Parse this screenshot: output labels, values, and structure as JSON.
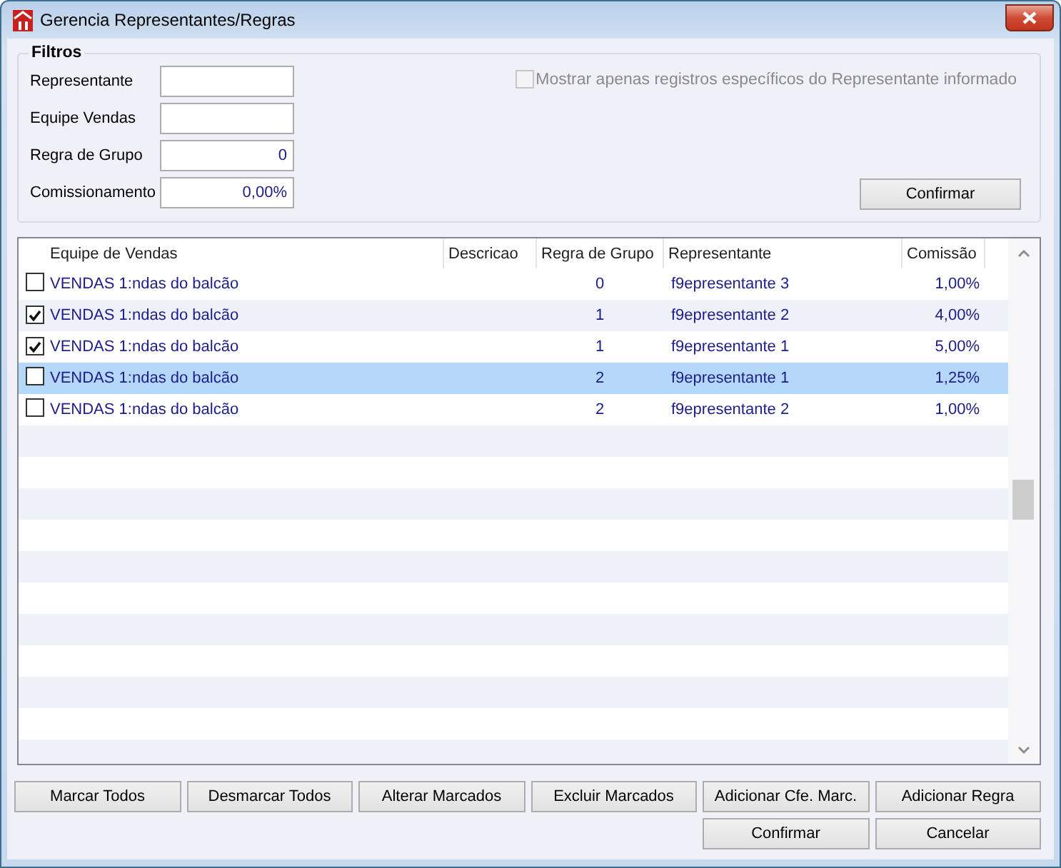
{
  "window": {
    "title": "Gerencia Representantes/Regras"
  },
  "filters": {
    "title": "Filtros",
    "fields": [
      {
        "label": "Representante"
      },
      {
        "label": "Equipe Vendas"
      },
      {
        "label": "Regra de Grupo",
        "value": "0"
      },
      {
        "label": "Comissionamento",
        "value": "0,00%"
      }
    ],
    "specific_only": {
      "label": "Mostrar apenas registros específicos do Representante informado",
      "checked": false,
      "disabled": true
    },
    "confirm_button": "Confirmar"
  },
  "table": {
    "columns": [
      "Equipe de Vendas",
      "Descricao",
      "Regra de Grupo",
      "Representante",
      "Comissão"
    ],
    "rows": [
      {
        "checked": false,
        "selected": false,
        "team": "VENDAS 1:ndas do balcão",
        "rule_group": "0",
        "representative": "f9epresentante 3",
        "commission": "1,00%"
      },
      {
        "checked": true,
        "selected": false,
        "team": "VENDAS 1:ndas do balcão",
        "rule_group": "1",
        "representative": "f9epresentante 2",
        "commission": "4,00%"
      },
      {
        "checked": true,
        "selected": false,
        "team": "VENDAS 1:ndas do balcão",
        "rule_group": "1",
        "representative": "f9epresentante 1",
        "commission": "5,00%"
      },
      {
        "checked": false,
        "selected": true,
        "team": "VENDAS 1:ndas do balcão",
        "rule_group": "2",
        "representative": "f9epresentante 1",
        "commission": "1,25%"
      },
      {
        "checked": false,
        "selected": false,
        "team": "VENDAS 1:ndas do balcão",
        "rule_group": "2",
        "representative": "f9epresentante 2",
        "commission": "1,00%"
      }
    ]
  },
  "actions": [
    "Marcar Todos",
    "Desmarcar Todos",
    "Alterar Marcados",
    "Excluir Marcados",
    "Adicionar Cfe. Marc.",
    "Adicionar Regra"
  ],
  "dialog_buttons": [
    "Confirmar",
    "Cancelar"
  ]
}
